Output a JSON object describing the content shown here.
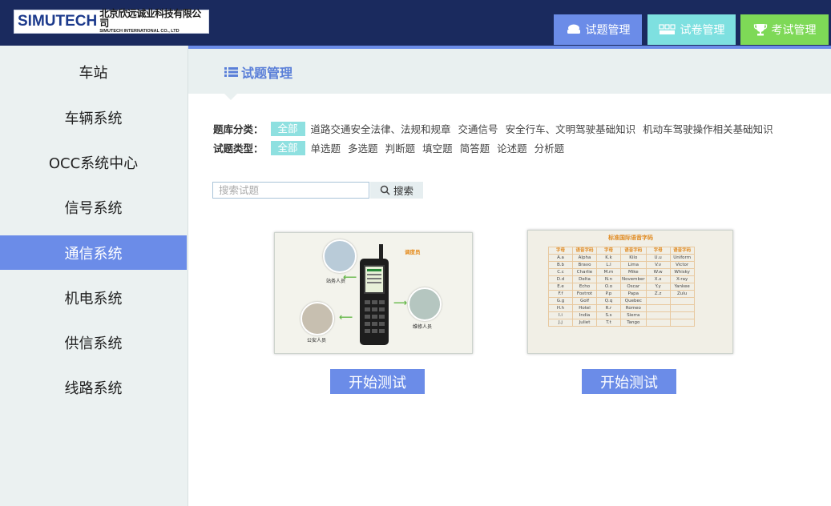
{
  "header": {
    "logo_main": "SIMUTECH",
    "logo_cn": "北京欣远诚业科技有限公司",
    "logo_en": "SIMUTECH INTERNATIONAL CO., LTD",
    "nav": [
      {
        "label": "试题管理",
        "color": "#6b8ce8"
      },
      {
        "label": "试卷管理",
        "color": "#7ee0e0"
      },
      {
        "label": "考试管理",
        "color": "#7ed957"
      }
    ]
  },
  "sidebar": {
    "items": [
      {
        "label": "车站"
      },
      {
        "label": "车辆系统"
      },
      {
        "label": "OCC系统中心"
      },
      {
        "label": "信号系统"
      },
      {
        "label": "通信系统",
        "active": true
      },
      {
        "label": "机电系统"
      },
      {
        "label": "供信系统"
      },
      {
        "label": "线路系统"
      }
    ]
  },
  "main": {
    "title": "试题管理",
    "filters": {
      "category_label": "题库分类：",
      "category_all": "全部",
      "categories": [
        "道路交通安全法律、法规和规章",
        "交通信号",
        "安全行车、文明驾驶基础知识",
        "机动车驾驶操作相关基础知识"
      ],
      "type_label": "试题类型：",
      "type_all": "全部",
      "types": [
        "单选题",
        "多选题",
        "判断题",
        "填空题",
        "简答题",
        "论述题",
        "分析题"
      ]
    },
    "search": {
      "placeholder": "搜索试题",
      "button": "搜索"
    },
    "cards": [
      {
        "button": "开始测试",
        "image": {
          "speech": [
            "调度员",
            "站务人员",
            "公安人员",
            "维修人员"
          ]
        }
      },
      {
        "button": "开始测试",
        "image": {
          "title": "标准国际语音字码",
          "headers": [
            "字母",
            "语音字码",
            "字母",
            "语音字码",
            "字母",
            "语音字码"
          ],
          "rows": [
            [
              "A.a",
              "Alpha",
              "K.k",
              "Kilo",
              "U.u",
              "Uniform"
            ],
            [
              "B.b",
              "Bravo",
              "L.l",
              "Lima",
              "V.v",
              "Victor"
            ],
            [
              "C.c",
              "Charlie",
              "M.m",
              "Mike",
              "W.w",
              "Whisky"
            ],
            [
              "D.d",
              "Delta",
              "N.n",
              "November",
              "X.x",
              "X-ray"
            ],
            [
              "E.e",
              "Echo",
              "O.o",
              "Oscar",
              "Y.y",
              "Yankee"
            ],
            [
              "F.f",
              "Foxtrot",
              "P.p",
              "Papa",
              "Z.z",
              "Zulu"
            ],
            [
              "G.g",
              "Golf",
              "Q.q",
              "Quebec",
              "",
              ""
            ],
            [
              "H.h",
              "Hotel",
              "R.r",
              "Romeo",
              "",
              ""
            ],
            [
              "I.i",
              "India",
              "S.s",
              "Sierra",
              "",
              ""
            ],
            [
              "J.j",
              "Juliet",
              "T.t",
              "Tango",
              "",
              ""
            ]
          ]
        }
      }
    ]
  }
}
